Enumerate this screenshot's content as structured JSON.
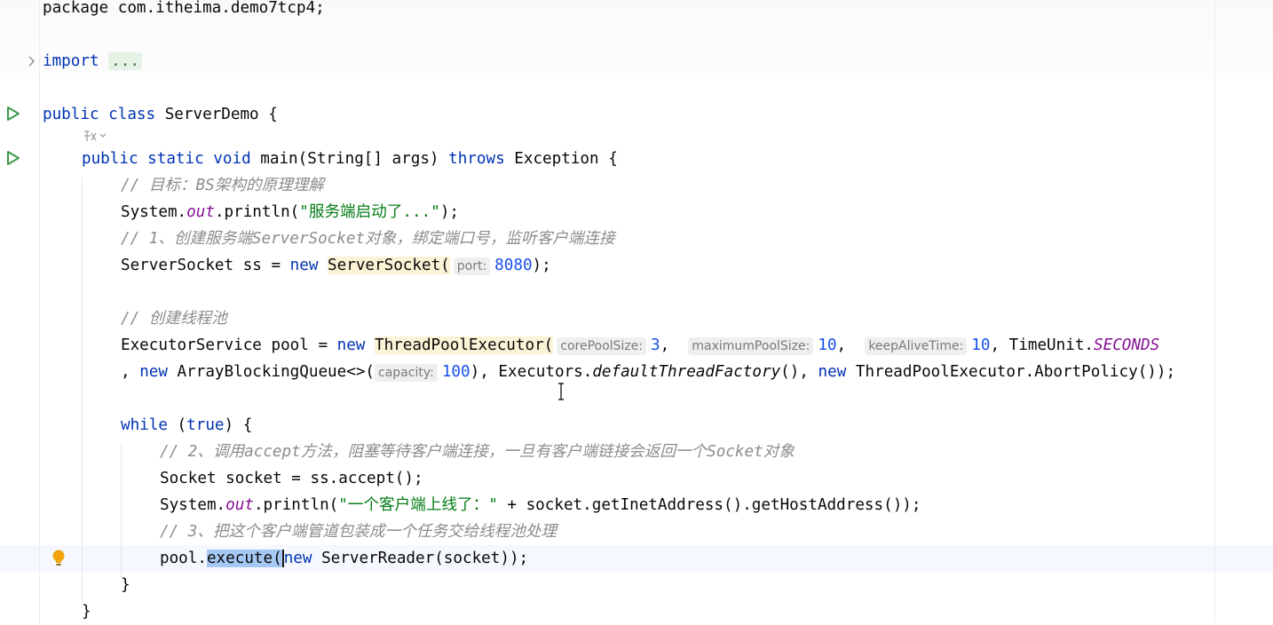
{
  "editor": {
    "package_line": "package com.itheima.demo7tcp4;",
    "import_keyword": "import",
    "import_folded": "...",
    "class_decl": {
      "kw": "public class",
      "name": "ServerDemo {"
    },
    "main_decl": {
      "kw1": "public static void",
      "name": "main(String[] args)",
      "kw2": "throws",
      "rest": "Exception {"
    },
    "comment_goal": "// 目标：BS架构的原理理解",
    "print_start": {
      "prefix": "System.",
      "field": "out",
      "mid": ".println(",
      "str": "\"服务端启动了...\"",
      "suffix": ");"
    },
    "comment_step1": "// 1、创建服务端ServerSocket对象，绑定端口号，监听客户端连接",
    "server_socket_line": {
      "prefix": "ServerSocket ss = ",
      "kw": "new",
      "ctor": "ServerSocket(",
      "hint": "port:",
      "value": "8080",
      "suffix": ");"
    },
    "comment_pool": "// 创建线程池",
    "pool_line1": {
      "prefix": "ExecutorService pool = ",
      "kw": "new",
      "ctor": "ThreadPoolExecutor(",
      "hint1": "corePoolSize:",
      "val1": "3",
      "sep1": ",",
      "hint2": "maximumPoolSize:",
      "val2": "10",
      "sep2": ",",
      "hint3": "keepAliveTime:",
      "val3": "10",
      "sep3": ", TimeUnit.",
      "field": "SECONDS"
    },
    "pool_line2": {
      "prefix": ", ",
      "kw1": "new",
      "mid1": " ArrayBlockingQueue<>(",
      "hint": "capacity:",
      "val": "100",
      "mid2": "), Executors.",
      "method": "defaultThreadFactory",
      "mid3": "(), ",
      "kw2": "new",
      "suffix": " ThreadPoolExecutor.AbortPolicy());"
    },
    "while_line": {
      "kw": "while",
      "mid": " (",
      "kw2": "true",
      "suffix": ") {"
    },
    "comment_step2": "// 2、调用accept方法，阻塞等待客户端连接，一旦有客户端链接会返回一个Socket对象",
    "accept_line": "Socket socket = ss.accept();",
    "print_client": {
      "prefix": "System.",
      "field": "out",
      "mid": ".println(",
      "str": "\"一个客户端上线了：\"",
      "suffix": " + socket.getInetAddress().getHostAddress());"
    },
    "comment_step3": "// 3、把这个客户端管道包装成一个任务交给线程池处理",
    "execute_line": {
      "prefix": "pool.",
      "selected": "execute(",
      "kw": "new",
      "suffix": " ServerReader(socket));"
    },
    "close_while": "}",
    "close_main": "}"
  },
  "colors": {
    "keyword": "#0033b3",
    "number": "#1750eb",
    "string": "#067d17",
    "comment": "#8c8c8c",
    "static_field": "#871094",
    "run_icon": "#3c9a4a",
    "bulb": "#f0a30a"
  },
  "icons": [
    "run-icon",
    "fold-arrow-icon",
    "ai-assist-icon",
    "lightbulb-icon",
    "text-cursor-icon"
  ]
}
